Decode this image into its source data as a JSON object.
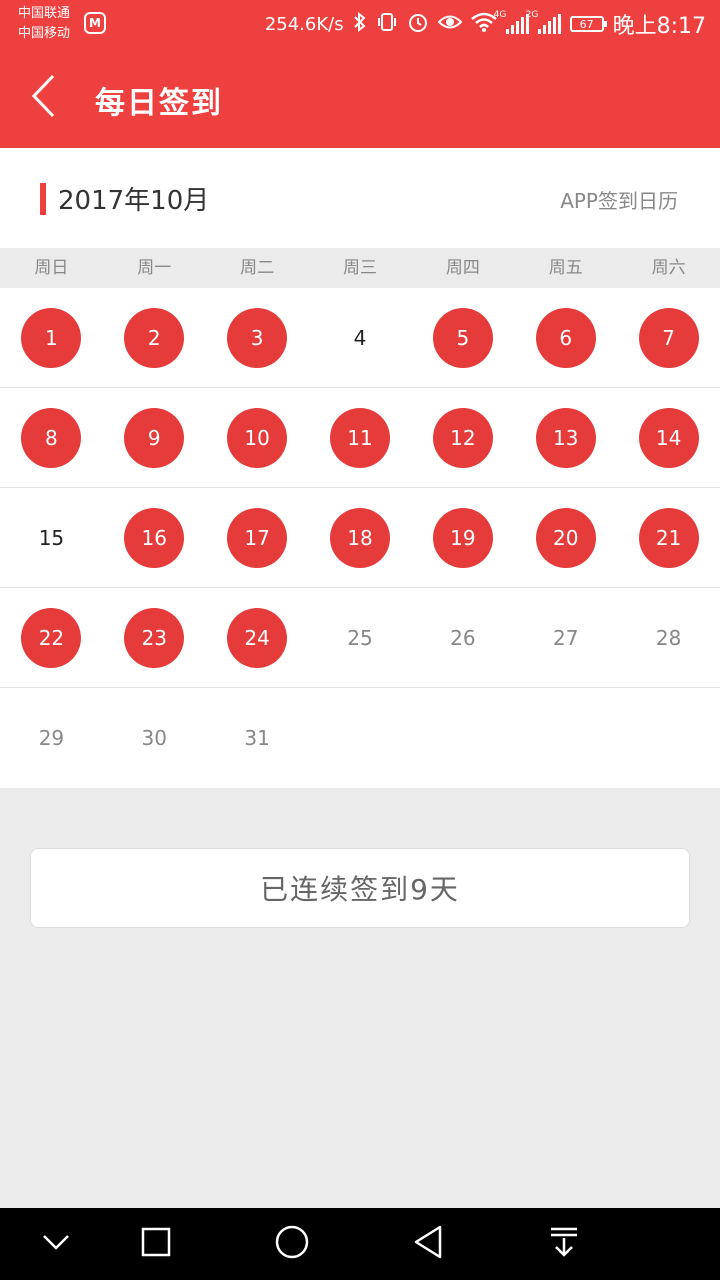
{
  "status_bar": {
    "carrier_1": "中国联通",
    "carrier_2": "中国移动",
    "app_badge": "M",
    "net_speed": "254.6K/s",
    "net_tag_1": "4G",
    "net_tag_2": "2G",
    "battery": "67",
    "time": "晚上8:17"
  },
  "header": {
    "title": "每日签到"
  },
  "month_header": {
    "month": "2017年10月",
    "calendar_link": "APP签到日历"
  },
  "weekdays": [
    "周日",
    "周一",
    "周二",
    "周三",
    "周四",
    "周五",
    "周六"
  ],
  "calendar": {
    "weeks": [
      [
        {
          "day": "1",
          "state": "signed"
        },
        {
          "day": "2",
          "state": "signed"
        },
        {
          "day": "3",
          "state": "signed"
        },
        {
          "day": "4",
          "state": "unsigned"
        },
        {
          "day": "5",
          "state": "signed"
        },
        {
          "day": "6",
          "state": "signed"
        },
        {
          "day": "7",
          "state": "signed"
        }
      ],
      [
        {
          "day": "8",
          "state": "signed"
        },
        {
          "day": "9",
          "state": "signed"
        },
        {
          "day": "10",
          "state": "signed"
        },
        {
          "day": "11",
          "state": "signed"
        },
        {
          "day": "12",
          "state": "signed"
        },
        {
          "day": "13",
          "state": "signed"
        },
        {
          "day": "14",
          "state": "signed"
        }
      ],
      [
        {
          "day": "15",
          "state": "unsigned"
        },
        {
          "day": "16",
          "state": "signed"
        },
        {
          "day": "17",
          "state": "signed"
        },
        {
          "day": "18",
          "state": "signed"
        },
        {
          "day": "19",
          "state": "signed"
        },
        {
          "day": "20",
          "state": "signed"
        },
        {
          "day": "21",
          "state": "signed"
        }
      ],
      [
        {
          "day": "22",
          "state": "signed"
        },
        {
          "day": "23",
          "state": "signed"
        },
        {
          "day": "24",
          "state": "signed"
        },
        {
          "day": "25",
          "state": "future"
        },
        {
          "day": "26",
          "state": "future"
        },
        {
          "day": "27",
          "state": "future"
        },
        {
          "day": "28",
          "state": "future"
        }
      ],
      [
        {
          "day": "29",
          "state": "future"
        },
        {
          "day": "30",
          "state": "future"
        },
        {
          "day": "31",
          "state": "future"
        },
        {
          "day": "",
          "state": "empty"
        },
        {
          "day": "",
          "state": "empty"
        },
        {
          "day": "",
          "state": "empty"
        },
        {
          "day": "",
          "state": "empty"
        }
      ]
    ]
  },
  "streak": {
    "text": "已连续签到9天"
  },
  "colors": {
    "brand_red": "#ef4040",
    "signed_circle": "#e63b3b",
    "background_gray": "#ebebeb"
  },
  "icons": {
    "back": "chevron-left-icon",
    "nav_down": "chevron-down-icon",
    "nav_recent": "square-icon",
    "nav_home": "circle-icon",
    "nav_back": "triangle-back-icon",
    "nav_notify": "pull-down-icon"
  }
}
